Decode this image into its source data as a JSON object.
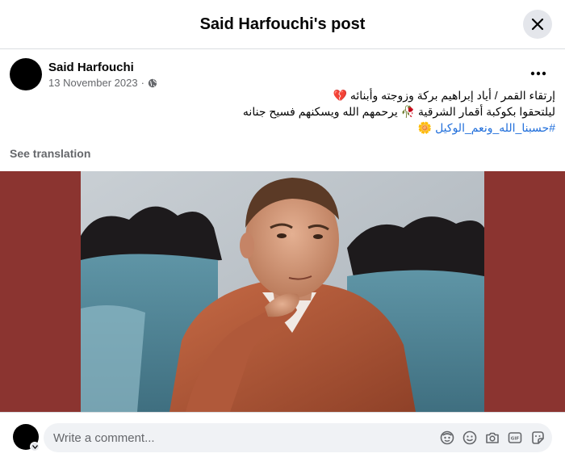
{
  "header": {
    "title": "Said Harfouchi's post"
  },
  "post": {
    "author": "Said Harfouchi",
    "date": "13 November 2023",
    "separator": "·",
    "text_line1": "إرتقاء القمر / أياد إبراهيم بركة وزوجته وأبنائه 💔",
    "text_line2": "ليلتحقوا بكوكبة أقمار الشرقية 🥀 يرحمهم الله ويسكنهم فسيح جنانه",
    "hashtag": "#حسبنا_الله_ونعم_الوكيل",
    "hashtag_emoji": "🌼",
    "see_translation": "See translation"
  },
  "comment": {
    "placeholder": "Write a comment..."
  },
  "icons": {
    "close": "close-icon",
    "more": "more-icon",
    "privacy": "globe-icon",
    "composer": [
      "avatar-sticker-icon",
      "emoji-icon",
      "camera-icon",
      "gif-icon",
      "sticker-icon"
    ]
  },
  "colors": {
    "photo_background": "#8b3430",
    "hashtag": "#216fdb",
    "secondary_text": "#65676b"
  }
}
